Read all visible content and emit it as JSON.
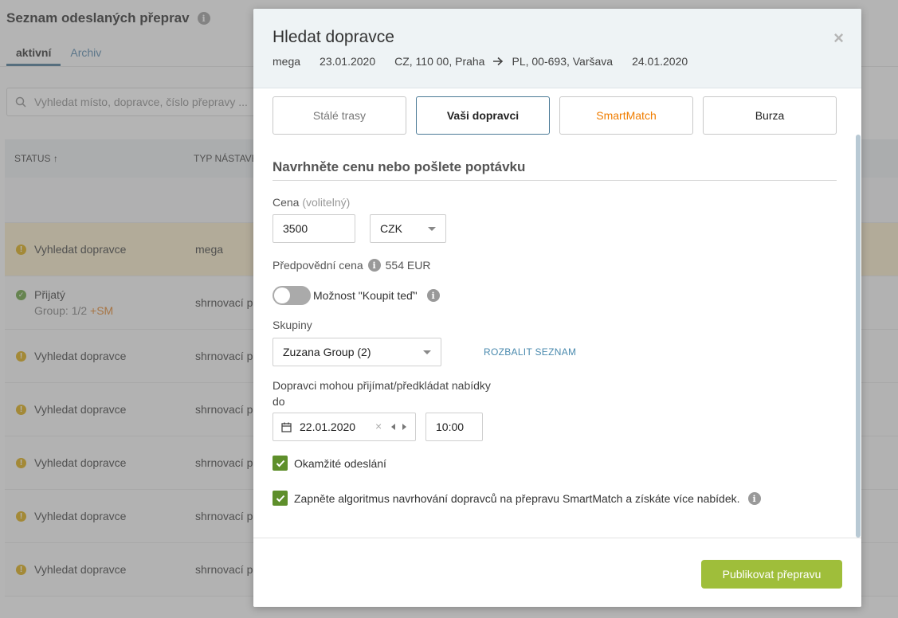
{
  "background": {
    "page_title": "Seznam odeslaných přeprav",
    "tabs": [
      "aktivní",
      "Archiv"
    ],
    "search_placeholder": "Vyhledat místo, dopravce, číslo přepravy ...",
    "table_headers": {
      "status": "STATUS ↑",
      "type": "TYP NÁSTAVBY"
    },
    "rows": [
      {
        "status": "Vyhledat dopravce",
        "type": "mega",
        "icon": "warning-icon"
      },
      {
        "status": "Přijatý",
        "sub": "Group: 1/2",
        "sub_badge": "+SM",
        "type": "shrnovací p",
        "icon": "check-icon"
      },
      {
        "status": "Vyhledat dopravce",
        "type": "shrnovací p",
        "icon": "warning-icon"
      },
      {
        "status": "Vyhledat dopravce",
        "type": "shrnovací p",
        "icon": "warning-icon"
      },
      {
        "status": "Vyhledat dopravce",
        "type": "shrnovací p",
        "icon": "warning-icon"
      },
      {
        "status": "Vyhledat dopravce",
        "type": "shrnovací p",
        "icon": "warning-icon"
      },
      {
        "status": "Vyhledat dopravce",
        "type": "shrnovací p",
        "icon": "warning-icon"
      }
    ]
  },
  "modal": {
    "title": "Hledat dopravce",
    "close": "×",
    "route": {
      "vehicle": "mega",
      "date_from": "23.01.2020",
      "from": "CZ, 110 00, Praha",
      "to": "PL, 00-693, Varšava",
      "date_to": "24.01.2020"
    },
    "tabs": [
      {
        "label": "Stálé trasy"
      },
      {
        "label": "Vaši dopravci"
      },
      {
        "label": "SmartMatch"
      },
      {
        "label": "Burza"
      }
    ],
    "section_title": "Navrhněte cenu nebo pošlete poptávku",
    "price": {
      "label": "Cena",
      "optional": "(volitelný)",
      "value": "3500",
      "currency": "CZK"
    },
    "predicted": {
      "label": "Předpovědní cena",
      "value": "554 EUR"
    },
    "buy_now": {
      "label": "Možnost \"Koupit teď\"",
      "enabled": false
    },
    "groups": {
      "label": "Skupiny",
      "value": "Zuzana Group (2)",
      "expand_link": "ROZBALIT SEZNAM"
    },
    "deadline": {
      "label_line1": "Dopravci mohou přijímat/předkládat nabídky",
      "label_line2": "do",
      "date": "22.01.2020",
      "time": "10:00"
    },
    "instant_send": {
      "label": "Okamžité odeslání",
      "checked": true
    },
    "smartmatch": {
      "label": "Zapněte algoritmus navrhování dopravců na přepravu SmartMatch a získáte více nabídek.",
      "checked": true
    },
    "publish_button": "Publikovat přepravu"
  },
  "colors": {
    "accent_green": "#9fbe3a",
    "checkbox_green": "#5e8f2b",
    "smartmatch_orange": "#f07d00",
    "link_blue": "#4a8aae"
  }
}
